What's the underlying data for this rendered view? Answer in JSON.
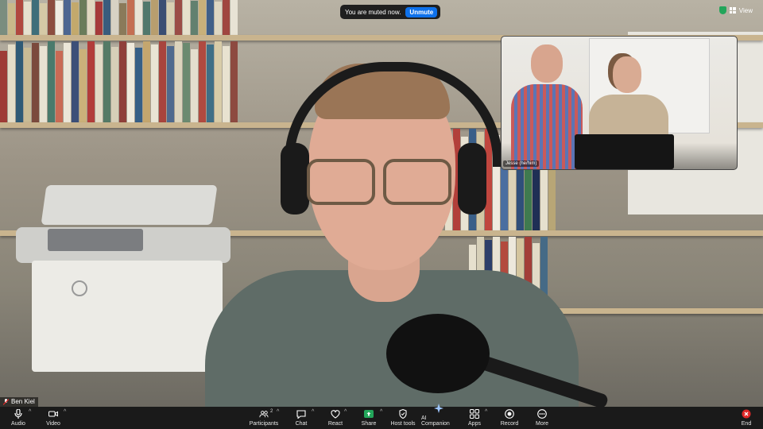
{
  "toast": {
    "message": "You are muted now.",
    "action": "Unmute"
  },
  "top_right": {
    "view_label": "View",
    "security_color": "#23a55a"
  },
  "self_view": {
    "name": "Ben Kiel"
  },
  "remote_tile": {
    "name": "Jesse (he/him)"
  },
  "toolbar": {
    "audio": "Audio",
    "video": "Video",
    "participants": "Participants",
    "participants_count": "2",
    "chat": "Chat",
    "react": "React",
    "share": "Share",
    "host_tools": "Host tools",
    "ai_companion": "AI Companion",
    "apps": "Apps",
    "record": "Record",
    "more": "More",
    "end": "End"
  },
  "colors": {
    "unmute": "#0e71eb",
    "share": "#23a55a",
    "end": "#e02828",
    "toolbar": "#1a1a1a"
  }
}
